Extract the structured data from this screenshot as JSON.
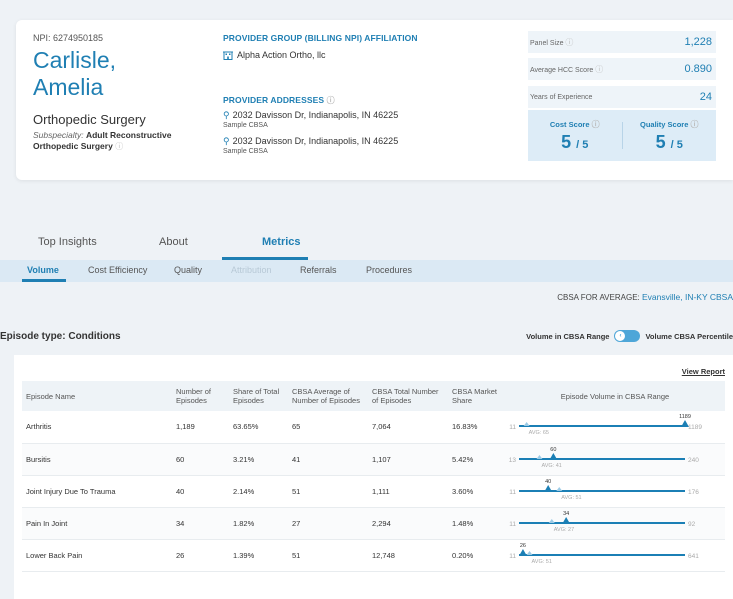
{
  "provider": {
    "npi": "NPI: 6274950185",
    "name_line1": "Carlisle,",
    "name_line2": "Amelia",
    "specialty": "Orthopedic Surgery",
    "subspecialty_label": "Subspecialty:",
    "subspecialty_value": "Adult Reconstructive Orthopedic Surgery"
  },
  "group": {
    "title": "PROVIDER GROUP (BILLING NPI) AFFILIATION",
    "name": "Alpha Action Ortho, llc"
  },
  "addresses": {
    "title": "PROVIDER ADDRESSES",
    "items": [
      {
        "street": "2032 Davisson Dr, Indianapolis, IN 46225",
        "cbsa": "Sample CBSA"
      },
      {
        "street": "2032 Davisson Dr, Indianapolis, IN 46225",
        "cbsa": "Sample CBSA"
      }
    ]
  },
  "stats": {
    "panel_size_label": "Panel Size",
    "panel_size": "1,228",
    "hcc_label": "Average HCC Score",
    "hcc": "0.890",
    "experience_label": "Years of Experience",
    "experience": "24",
    "cost_label": "Cost Score",
    "cost_value": "5",
    "cost_max": "/ 5",
    "quality_label": "Quality Score",
    "quality_value": "5",
    "quality_max": "/ 5"
  },
  "tabs": [
    "Top Insights",
    "About",
    "Metrics"
  ],
  "subtabs": [
    "Volume",
    "Cost Efficiency",
    "Quality",
    "Attribution",
    "Referrals",
    "Procedures"
  ],
  "cbsa_average": {
    "label": "CBSA FOR AVERAGE:",
    "value": "Evansville, IN-KY CBSA"
  },
  "episode_type": "Episode type: Conditions",
  "toggle": {
    "left": "Volume in CBSA Range",
    "right": "Volume CBSA Percentile"
  },
  "view_report": "View Report",
  "table": {
    "headers": [
      "Episode Name",
      "Number of Episodes",
      "Share of Total Episodes",
      "CBSA Average of Number of Episodes",
      "CBSA Total Number of Episodes",
      "CBSA Market Share",
      "Episode Volume in CBSA Range"
    ],
    "rows": [
      {
        "name": "Arthritis",
        "episodes": "1,189",
        "share": "63.65%",
        "cbsa_avg": "65",
        "cbsa_total": "7,064",
        "market_share": "16.83%",
        "range": {
          "min": 11,
          "max": 1189,
          "avg": 65,
          "value": 1189,
          "avg_label": "AVG: 65",
          "value_label": "1189"
        }
      },
      {
        "name": "Bursitis",
        "episodes": "60",
        "share": "3.21%",
        "cbsa_avg": "41",
        "cbsa_total": "1,107",
        "market_share": "5.42%",
        "range": {
          "min": 13,
          "max": 240,
          "avg": 41,
          "value": 60,
          "avg_label": "AVG: 41",
          "value_label": "60"
        }
      },
      {
        "name": "Joint Injury Due To Trauma",
        "episodes": "40",
        "share": "2.14%",
        "cbsa_avg": "51",
        "cbsa_total": "1,111",
        "market_share": "3.60%",
        "range": {
          "min": 11,
          "max": 176,
          "avg": 51,
          "value": 40,
          "avg_label": "AVG: 51",
          "value_label": "40"
        }
      },
      {
        "name": "Pain In Joint",
        "episodes": "34",
        "share": "1.82%",
        "cbsa_avg": "27",
        "cbsa_total": "2,294",
        "market_share": "1.48%",
        "range": {
          "min": 11,
          "max": 92,
          "avg": 27,
          "value": 34,
          "avg_label": "AVG: 27",
          "value_label": "34"
        }
      },
      {
        "name": "Lower Back Pain",
        "episodes": "26",
        "share": "1.39%",
        "cbsa_avg": "51",
        "cbsa_total": "12,748",
        "market_share": "0.20%",
        "range": {
          "min": 11,
          "max": 641,
          "avg": 51,
          "value": 26,
          "avg_label": "AVG: 51",
          "value_label": "26"
        }
      }
    ]
  },
  "colors": {
    "accent": "#1f7fb3",
    "range_line": "#1b7fb5",
    "range_light": "#cde4f2"
  }
}
